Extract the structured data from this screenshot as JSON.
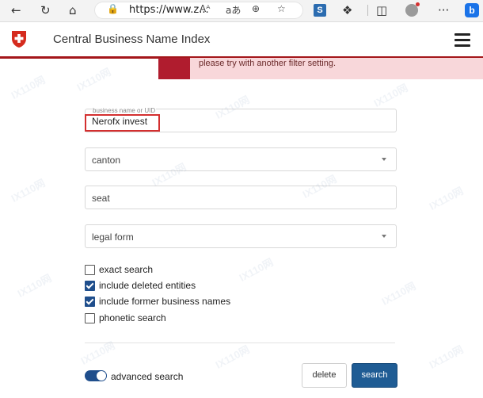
{
  "browser": {
    "url_display": "https://www.z...",
    "icons": {
      "back": "back-arrow-icon",
      "refresh": "refresh-icon",
      "home": "home-icon",
      "lock": "lock-icon",
      "read_aloud": "read-aloud-icon",
      "translate": "translate-icon",
      "zoom": "zoom-icon",
      "favorite": "star-icon",
      "extensions": "puzzle-icon",
      "split": "split-screen-icon",
      "profile": "profile-icon",
      "more": "more-icon",
      "bing": "bing-icon"
    },
    "read_aloud_glyph": "Aᴬ",
    "translate_glyph": "aあ",
    "more_glyph": "···"
  },
  "header": {
    "title": "Central Business Name Index",
    "brand_color": "#a4161a"
  },
  "alert": {
    "text": "please try with another filter setting."
  },
  "form": {
    "business_name": {
      "label": "business name or UID",
      "value": "Nerofx invest"
    },
    "canton": {
      "placeholder": "canton"
    },
    "seat": {
      "placeholder": "seat"
    },
    "legal_form": {
      "placeholder": "legal form"
    },
    "checkboxes": [
      {
        "label": "exact search",
        "checked": false
      },
      {
        "label": "include deleted entities",
        "checked": true
      },
      {
        "label": "include former business names",
        "checked": true
      },
      {
        "label": "phonetic search",
        "checked": false
      }
    ],
    "advanced_search": {
      "label": "advanced search",
      "on": true
    },
    "delete_label": "delete",
    "search_label": "search",
    "accent_color": "#1f5c94"
  }
}
